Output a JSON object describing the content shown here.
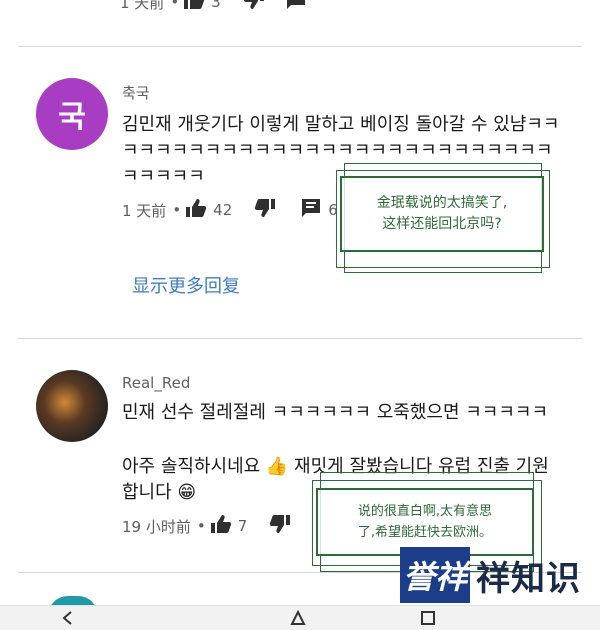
{
  "top_partial": {
    "time": "1 天前",
    "likes": "3"
  },
  "comment1": {
    "avatar_letter": "국",
    "avatar_color": "#a83dc4",
    "username": "축국",
    "text": "김민재 개웃기다 이렇게 말하고 베이징 돌아갈 수 있냠ㅋㅋㅋㅋㅋㅋㅋㅋㅋㅋㅋㅋㅋㅋㅋㅋㅋㅋㅋㅋㅋㅋㅋㅋㅋㅋㅋㅋㅋㅋㅋㅋㅋ",
    "time": "1 天前",
    "likes": "42",
    "replies": "6",
    "annotation": [
      "金珉载说的太搞笑了,",
      "这样还能回北京吗?"
    ]
  },
  "show_more_label": "显示更多回复",
  "comment2": {
    "username": "Real_Red",
    "text_line1": "민재 선수 절레절레 ㅋㅋㅋㅋㅋㅋ 오죽했으면 ㅋㅋㅋㅋㅋ",
    "text_para2": "아주 솔직하시네요 👍 재밋게 잘봤습니다 유럽 진출 기원합니다 😁",
    "time": "19 小时前",
    "likes": "7",
    "annotation": [
      "说的很直白啊,太有意思",
      "了,希望能赶快去欧洲。"
    ]
  },
  "logo": {
    "mark": "誉祥",
    "text": "祥知识"
  }
}
